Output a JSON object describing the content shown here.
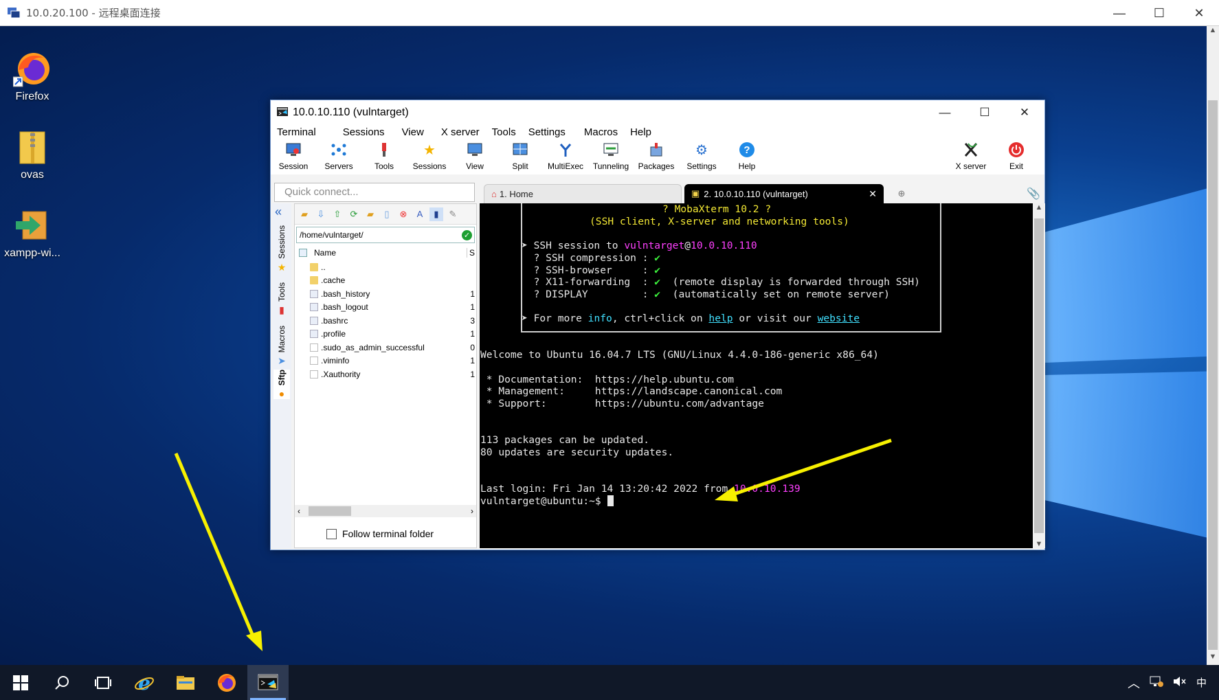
{
  "rdp": {
    "title": "10.0.20.100 - 远程桌面连接",
    "minimize": "—",
    "maximize": "☐",
    "close": "✕"
  },
  "desktop_icons": [
    {
      "label": "Firefox",
      "icon": "firefox-icon"
    },
    {
      "label": "ovas",
      "icon": "zip-folder-icon"
    },
    {
      "label": "xampp-wi...",
      "icon": "installer-icon"
    }
  ],
  "moba": {
    "title": "10.0.10.110 (vulntarget)",
    "menu": [
      "Terminal",
      "Sessions",
      "View",
      "X server",
      "Tools",
      "Settings",
      "Macros",
      "Help"
    ],
    "toolbar": [
      "Session",
      "Servers",
      "Tools",
      "Sessions",
      "View",
      "Split",
      "MultiExec",
      "Tunneling",
      "Packages",
      "Settings",
      "Help"
    ],
    "toolbar_right": [
      "X server",
      "Exit"
    ],
    "quick_connect_placeholder": "Quick connect...",
    "tabs": {
      "home": "1. Home",
      "ssh": "2. 10.0.10.110 (vulntarget)",
      "close": "✕"
    },
    "side_tabs": [
      "Sessions",
      "Tools",
      "Macros",
      "Sftp"
    ],
    "sftp": {
      "path": "/home/vulntarget/",
      "col_name": "Name",
      "col_size": "S",
      "files": [
        {
          "name": "..",
          "type": "folder",
          "size": ""
        },
        {
          "name": ".cache",
          "type": "folder",
          "size": ""
        },
        {
          "name": ".bash_history",
          "type": "file",
          "size": "1"
        },
        {
          "name": ".bash_logout",
          "type": "file",
          "size": "1"
        },
        {
          "name": ".bashrc",
          "type": "file",
          "size": "3"
        },
        {
          "name": ".profile",
          "type": "file",
          "size": "1"
        },
        {
          "name": ".sudo_as_admin_successful",
          "type": "blank",
          "size": "0"
        },
        {
          "name": ".viminfo",
          "type": "blank",
          "size": "1"
        },
        {
          "name": ".Xauthority",
          "type": "blank",
          "size": "1"
        }
      ],
      "follow_label": "Follow terminal folder"
    },
    "terminal": {
      "banner1": "? MobaXterm 10.2 ?",
      "banner2": "(SSH client, X-server and networking tools)",
      "ssh_prefix": "➤ SSH session to ",
      "ssh_user": "vulntarget",
      "ssh_at": "@",
      "ssh_host": "10.0.10.110",
      "opt1_label": "  ? SSH compression : ",
      "opt2_label": "  ? SSH-browser     : ",
      "opt3_label": "  ? X11-forwarding  : ",
      "opt3_note": "  (remote display is forwarded through SSH)",
      "opt4_label": "  ? DISPLAY         : ",
      "opt4_note": "  (automatically set on remote server)",
      "check": "✔",
      "more_prefix": "➤ For more ",
      "more_info": "info",
      "more_mid": ", ctrl+click on ",
      "more_help": "help",
      "more_mid2": " or visit our ",
      "more_website": "website",
      "welcome": "Welcome to Ubuntu 16.04.7 LTS (GNU/Linux 4.4.0-186-generic x86_64)",
      "doc": " * Documentation:  https://help.ubuntu.com",
      "mgmt": " * Management:     https://landscape.canonical.com",
      "support": " * Support:        https://ubuntu.com/advantage",
      "pkgs": "113 packages can be updated.",
      "sec": "80 updates are security updates.",
      "last_login_prefix": "Last login: Fri Jan 14 13:20:42 2022 from ",
      "last_login_ip": "10.0.10.139",
      "prompt": "vulntarget@ubuntu:~$ "
    }
  },
  "taskbar": {
    "tray_lang": "中",
    "tray_caret": "^"
  }
}
